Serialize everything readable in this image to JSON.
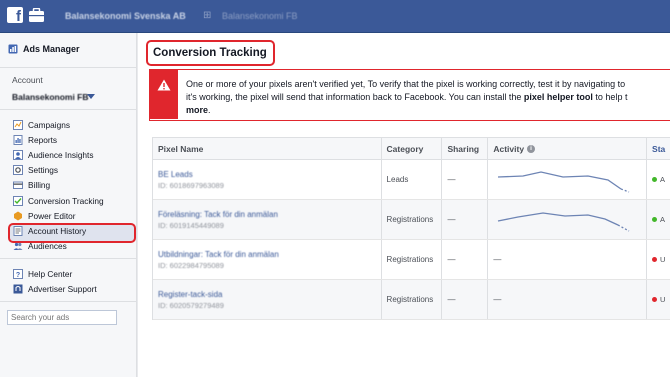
{
  "topbar": {
    "logo_letter": "f",
    "crumb_business": "Balansekonomi Svenska AB",
    "crumb_separator": "⊞",
    "crumb_account": "Balansekonomi FB"
  },
  "sidebar": {
    "ads_manager_label": "Ads Manager",
    "account_label": "Account",
    "account_name": "Balansekonomi FB",
    "nav_items": [
      {
        "label": "Campaigns",
        "icon": "campaigns-icon"
      },
      {
        "label": "Reports",
        "icon": "reports-icon"
      },
      {
        "label": "Audience Insights",
        "icon": "audience-insights-icon"
      },
      {
        "label": "Settings",
        "icon": "settings-icon"
      },
      {
        "label": "Billing",
        "icon": "billing-icon"
      },
      {
        "label": "Conversion Tracking",
        "icon": "conversion-tracking-icon"
      },
      {
        "label": "Power Editor",
        "icon": "power-editor-icon"
      },
      {
        "label": "Account History",
        "icon": "account-history-icon"
      },
      {
        "label": "Audiences",
        "icon": "audiences-icon"
      }
    ],
    "active_index": 5,
    "help_items": [
      {
        "label": "Help Center",
        "icon": "help-center-icon"
      },
      {
        "label": "Advertiser Support",
        "icon": "advertiser-support-icon"
      }
    ],
    "search_placeholder": "Search your ads"
  },
  "main": {
    "title": "Conversion Tracking",
    "alert": {
      "line1": "One or more of your pixels aren't verified yet, To verify that the pixel is working correctly, test it by navigating to",
      "line2_start": "it's working, the pixel will send that information back to Facebook. You can install the ",
      "line2_bold": "pixel helper tool",
      "line2_end": " to help t",
      "line3_bold": "more",
      "line3_end": "."
    },
    "table": {
      "headers": {
        "name": "Pixel Name",
        "category": "Category",
        "sharing": "Sharing",
        "activity": "Activity",
        "status": "Sta"
      },
      "rows": [
        {
          "name": "BE Leads",
          "id": "ID: 6018697963089",
          "category": "Leads",
          "sharing": "—",
          "activity": "",
          "status_color": "#42b72a",
          "status_text": "A"
        },
        {
          "name": "Föreläsning: Tack för din anmälan",
          "id": "ID: 6019145449089",
          "category": "Registrations",
          "sharing": "—",
          "activity": "",
          "status_color": "#42b72a",
          "status_text": "A"
        },
        {
          "name": "Utbildningar: Tack för din anmälan",
          "id": "ID: 6022984795089",
          "category": "Registrations",
          "sharing": "—",
          "activity": "—",
          "status_color": "#e0262d",
          "status_text": "U"
        },
        {
          "name": "Register-tack-sida",
          "id": "ID: 6020579279489",
          "category": "Registrations",
          "sharing": "—",
          "activity": "—",
          "status_color": "#e0262d",
          "status_text": "U"
        }
      ]
    }
  },
  "colors": {
    "facebook_blue": "#3b5998",
    "highlight_red": "#e0262d",
    "active_green": "#42b72a",
    "sparkline": "#6d84b4"
  }
}
